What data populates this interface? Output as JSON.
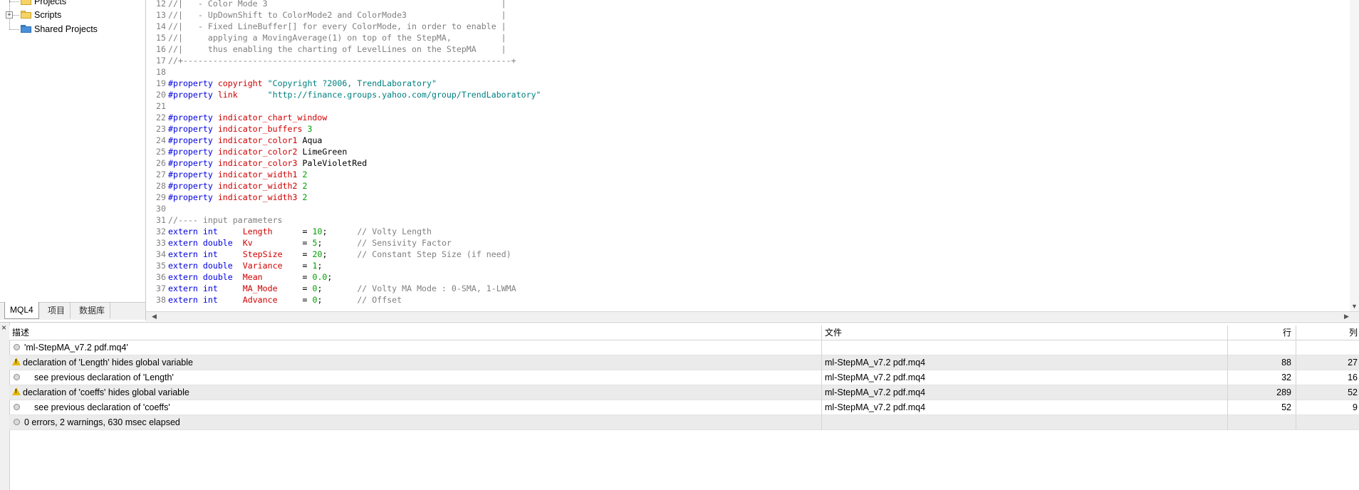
{
  "navigator": {
    "items": [
      {
        "label": "Projects",
        "kind": "folder"
      },
      {
        "label": "Scripts",
        "kind": "folder"
      },
      {
        "label": "Shared Projects",
        "kind": "shared"
      }
    ],
    "tabs": [
      "MQL4",
      "项目",
      "数据库"
    ]
  },
  "editor": {
    "lines": [
      {
        "n": "12",
        "tokens": [
          [
            "cm",
            "//|   - Color Mode 3                                               |"
          ]
        ]
      },
      {
        "n": "13",
        "tokens": [
          [
            "cm",
            "//|   - UpDownShift to ColorMode2 and ColorMode3                   |"
          ]
        ]
      },
      {
        "n": "14",
        "tokens": [
          [
            "cm",
            "//|   - Fixed LineBuffer[] for every ColorMode, in order to enable |"
          ]
        ]
      },
      {
        "n": "15",
        "tokens": [
          [
            "cm",
            "//|     applying a MovingAverage(1) on top of the StepMA,          |"
          ]
        ]
      },
      {
        "n": "16",
        "tokens": [
          [
            "cm",
            "//|     thus enabling the charting of LevelLines on the StepMA     |"
          ]
        ]
      },
      {
        "n": "17",
        "tokens": [
          [
            "cm",
            "//+------------------------------------------------------------------+"
          ]
        ]
      },
      {
        "n": "18",
        "tokens": []
      },
      {
        "n": "19",
        "tokens": [
          [
            "pp",
            "#property"
          ],
          [
            "plain",
            " "
          ],
          [
            "kw",
            "copyright"
          ],
          [
            "plain",
            " "
          ],
          [
            "str",
            "\"Copyright ?2006, TrendLaboratory\""
          ]
        ]
      },
      {
        "n": "20",
        "tokens": [
          [
            "pp",
            "#property"
          ],
          [
            "plain",
            " "
          ],
          [
            "kw",
            "link"
          ],
          [
            "plain",
            "      "
          ],
          [
            "str",
            "\"http://finance.groups.yahoo.com/group/TrendLaboratory\""
          ]
        ]
      },
      {
        "n": "21",
        "tokens": []
      },
      {
        "n": "22",
        "tokens": [
          [
            "pp",
            "#property"
          ],
          [
            "plain",
            " "
          ],
          [
            "kw",
            "indicator_chart_window"
          ]
        ]
      },
      {
        "n": "23",
        "tokens": [
          [
            "pp",
            "#property"
          ],
          [
            "plain",
            " "
          ],
          [
            "kw",
            "indicator_buffers"
          ],
          [
            "plain",
            " "
          ],
          [
            "num",
            "3"
          ]
        ]
      },
      {
        "n": "24",
        "tokens": [
          [
            "pp",
            "#property"
          ],
          [
            "plain",
            " "
          ],
          [
            "kw",
            "indicator_color1"
          ],
          [
            "plain",
            " Aqua"
          ]
        ]
      },
      {
        "n": "25",
        "tokens": [
          [
            "pp",
            "#property"
          ],
          [
            "plain",
            " "
          ],
          [
            "kw",
            "indicator_color2"
          ],
          [
            "plain",
            " LimeGreen"
          ]
        ]
      },
      {
        "n": "26",
        "tokens": [
          [
            "pp",
            "#property"
          ],
          [
            "plain",
            " "
          ],
          [
            "kw",
            "indicator_color3"
          ],
          [
            "plain",
            " PaleVioletRed"
          ]
        ]
      },
      {
        "n": "27",
        "tokens": [
          [
            "pp",
            "#property"
          ],
          [
            "plain",
            " "
          ],
          [
            "kw",
            "indicator_width1"
          ],
          [
            "plain",
            " "
          ],
          [
            "num",
            "2"
          ]
        ]
      },
      {
        "n": "28",
        "tokens": [
          [
            "pp",
            "#property"
          ],
          [
            "plain",
            " "
          ],
          [
            "kw",
            "indicator_width2"
          ],
          [
            "plain",
            " "
          ],
          [
            "num",
            "2"
          ]
        ]
      },
      {
        "n": "29",
        "tokens": [
          [
            "pp",
            "#property"
          ],
          [
            "plain",
            " "
          ],
          [
            "kw",
            "indicator_width3"
          ],
          [
            "plain",
            " "
          ],
          [
            "num",
            "2"
          ]
        ]
      },
      {
        "n": "30",
        "tokens": []
      },
      {
        "n": "31",
        "tokens": [
          [
            "cm",
            "//---- input parameters"
          ]
        ]
      },
      {
        "n": "32",
        "tokens": [
          [
            "type",
            "extern"
          ],
          [
            "plain",
            " "
          ],
          [
            "type",
            "int"
          ],
          [
            "plain",
            "     "
          ],
          [
            "id",
            "Length"
          ],
          [
            "plain",
            "      = "
          ],
          [
            "num",
            "10"
          ],
          [
            "plain",
            ";      "
          ],
          [
            "cm",
            "// Volty Length"
          ]
        ]
      },
      {
        "n": "33",
        "tokens": [
          [
            "type",
            "extern"
          ],
          [
            "plain",
            " "
          ],
          [
            "type",
            "double"
          ],
          [
            "plain",
            "  "
          ],
          [
            "id",
            "Kv"
          ],
          [
            "plain",
            "          = "
          ],
          [
            "num",
            "5"
          ],
          [
            "plain",
            ";       "
          ],
          [
            "cm",
            "// Sensivity Factor"
          ]
        ]
      },
      {
        "n": "34",
        "tokens": [
          [
            "type",
            "extern"
          ],
          [
            "plain",
            " "
          ],
          [
            "type",
            "int"
          ],
          [
            "plain",
            "     "
          ],
          [
            "id",
            "StepSize"
          ],
          [
            "plain",
            "    = "
          ],
          [
            "num",
            "20"
          ],
          [
            "plain",
            ";      "
          ],
          [
            "cm",
            "// Constant Step Size (if need)"
          ]
        ]
      },
      {
        "n": "35",
        "tokens": [
          [
            "type",
            "extern"
          ],
          [
            "plain",
            " "
          ],
          [
            "type",
            "double"
          ],
          [
            "plain",
            "  "
          ],
          [
            "id",
            "Variance"
          ],
          [
            "plain",
            "    = "
          ],
          [
            "num",
            "1"
          ],
          [
            "plain",
            ";"
          ]
        ]
      },
      {
        "n": "36",
        "tokens": [
          [
            "type",
            "extern"
          ],
          [
            "plain",
            " "
          ],
          [
            "type",
            "double"
          ],
          [
            "plain",
            "  "
          ],
          [
            "id",
            "Mean"
          ],
          [
            "plain",
            "        = "
          ],
          [
            "num",
            "0.0"
          ],
          [
            "plain",
            ";"
          ]
        ]
      },
      {
        "n": "37",
        "tokens": [
          [
            "type",
            "extern"
          ],
          [
            "plain",
            " "
          ],
          [
            "type",
            "int"
          ],
          [
            "plain",
            "     "
          ],
          [
            "id",
            "MA_Mode"
          ],
          [
            "plain",
            "     = "
          ],
          [
            "num",
            "0"
          ],
          [
            "plain",
            ";       "
          ],
          [
            "cm",
            "// Volty MA Mode : 0-SMA, 1-LWMA"
          ]
        ]
      },
      {
        "n": "38",
        "tokens": [
          [
            "type",
            "extern"
          ],
          [
            "plain",
            " "
          ],
          [
            "type",
            "int"
          ],
          [
            "plain",
            "     "
          ],
          [
            "id",
            "Advance"
          ],
          [
            "plain",
            "     = "
          ],
          [
            "num",
            "0"
          ],
          [
            "plain",
            ";       "
          ],
          [
            "cm",
            "// Offset"
          ]
        ]
      }
    ]
  },
  "toolbox": {
    "close_glyph": "×",
    "headers": {
      "desc": "描述",
      "file": "文件",
      "line": "行",
      "col": "列"
    },
    "rows": [
      {
        "icon": "info",
        "desc": "'ml-StepMA_v7.2 pdf.mq4'",
        "file": "",
        "line": "",
        "col": "",
        "indent": false
      },
      {
        "icon": "warning",
        "desc": "declaration of 'Length' hides global variable",
        "file": "ml-StepMA_v7.2 pdf.mq4",
        "line": "88",
        "col": "27",
        "indent": false
      },
      {
        "icon": "info",
        "desc": "see previous declaration of 'Length'",
        "file": "ml-StepMA_v7.2 pdf.mq4",
        "line": "32",
        "col": "16",
        "indent": true
      },
      {
        "icon": "warning",
        "desc": "declaration of 'coeffs' hides global variable",
        "file": "ml-StepMA_v7.2 pdf.mq4",
        "line": "289",
        "col": "52",
        "indent": false
      },
      {
        "icon": "info",
        "desc": "see previous declaration of 'coeffs'",
        "file": "ml-StepMA_v7.2 pdf.mq4",
        "line": "52",
        "col": "9",
        "indent": true
      },
      {
        "icon": "info",
        "desc": "0 errors, 2 warnings, 630 msec elapsed",
        "file": "",
        "line": "",
        "col": "",
        "indent": false
      }
    ]
  }
}
